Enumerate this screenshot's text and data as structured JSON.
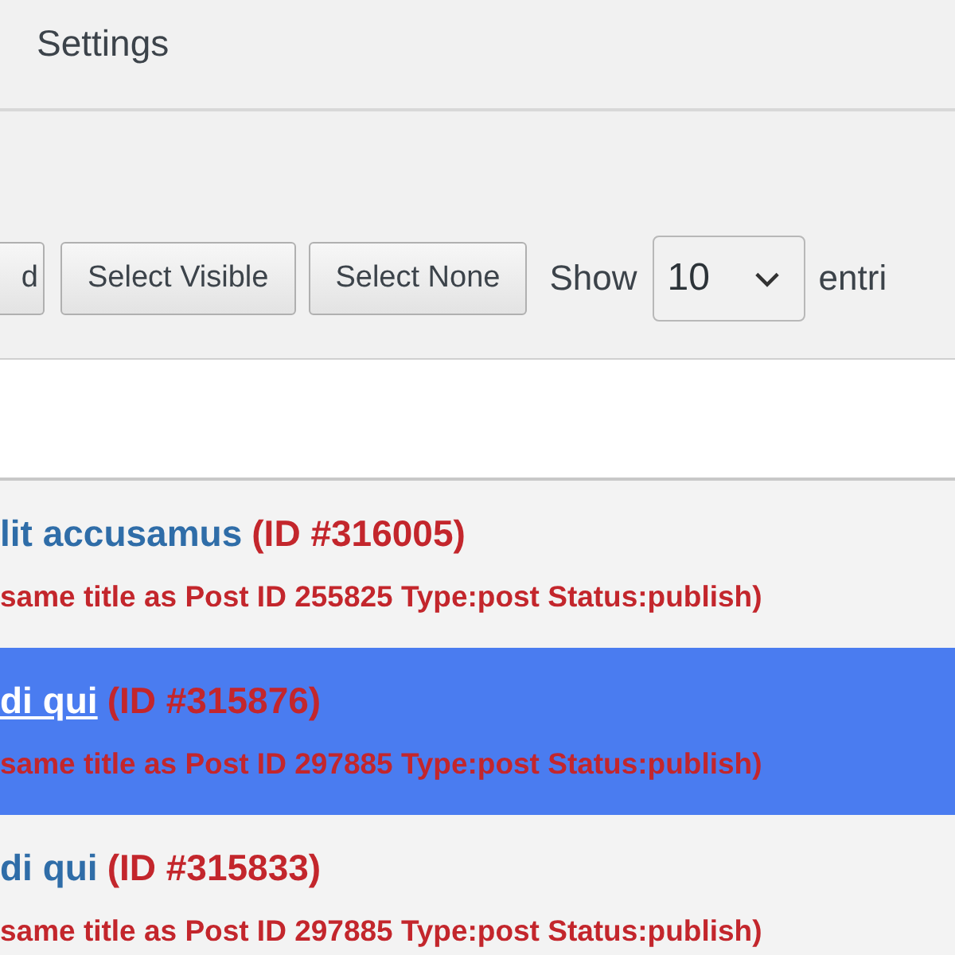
{
  "header": {
    "title": "Settings"
  },
  "toolbar": {
    "buttons": [
      {
        "label": "d"
      },
      {
        "label": "Select Visible"
      },
      {
        "label": "Select None"
      }
    ],
    "show_label": "Show",
    "page_size": {
      "value": "10"
    },
    "entries_label": "entri"
  },
  "rows": [
    {
      "title": "lit accusamus",
      "id": "(ID #316005)",
      "note": "same title as Post ID 255825 Type:post Status:publish)",
      "selected": false
    },
    {
      "title": "di qui",
      "id": "(ID #315876)",
      "note": "same title as Post ID 297885 Type:post Status:publish)",
      "selected": true
    },
    {
      "title": "di qui",
      "id": "(ID #315833)",
      "note": "same title as Post ID 297885 Type:post Status:publish)",
      "selected": false
    }
  ]
}
